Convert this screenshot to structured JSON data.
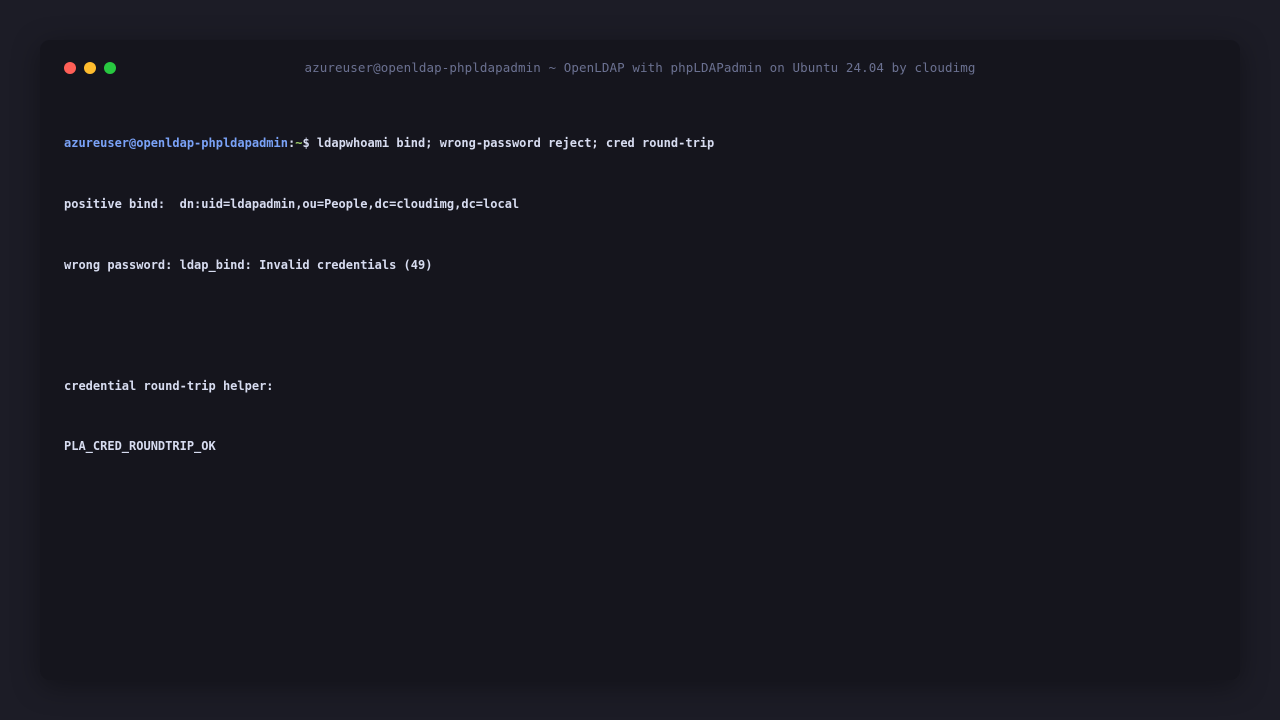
{
  "window": {
    "title": "azureuser@openldap-phpldapadmin ~ OpenLDAP with phpLDAPadmin on Ubuntu 24.04 by cloudimg",
    "buttons": {
      "close_color": "#ff5f57",
      "minimize_color": "#febc2e",
      "maximize_color": "#28c840"
    }
  },
  "terminal": {
    "prompt": {
      "user_host": "azureuser@openldap-phpldapadmin",
      "separator": ":",
      "path": "~",
      "symbol": "$ ",
      "command": "ldapwhoami bind; wrong-password reject; cred round-trip"
    },
    "output": [
      "positive bind:  dn:uid=ldapadmin,ou=People,dc=cloudimg,dc=local",
      "wrong password: ldap_bind: Invalid credentials (49)",
      "",
      "credential round-trip helper:",
      "PLA_CRED_ROUNDTRIP_OK"
    ]
  },
  "colors": {
    "background": "#1c1c26",
    "window_background": "#15151d",
    "prompt_user": "#7aa2f7",
    "prompt_path": "#9ece6a",
    "text": "#d7dcf0",
    "title_text": "#6b7191"
  }
}
